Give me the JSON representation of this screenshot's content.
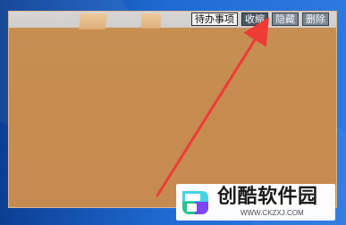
{
  "widget": {
    "controls": {
      "todo_label": "待办事项",
      "collapse_label": "收缩",
      "hide_label": "隐藏",
      "delete_label": "删除"
    }
  },
  "logo": {
    "title": "创酷软件园",
    "url": "WWW.CKZXJ.COM",
    "icon_name": "chuangku-logo-icon"
  },
  "annotation": {
    "arrow_icon": "red-arrow-icon"
  },
  "colors": {
    "background_blue": "#1f6bd2",
    "widget_brown": "#c68c4f",
    "arrow_red": "#ef3b36",
    "logo_cyan": "#46d4e2",
    "logo_green": "#22c58a",
    "logo_purple": "#7a47f2"
  }
}
